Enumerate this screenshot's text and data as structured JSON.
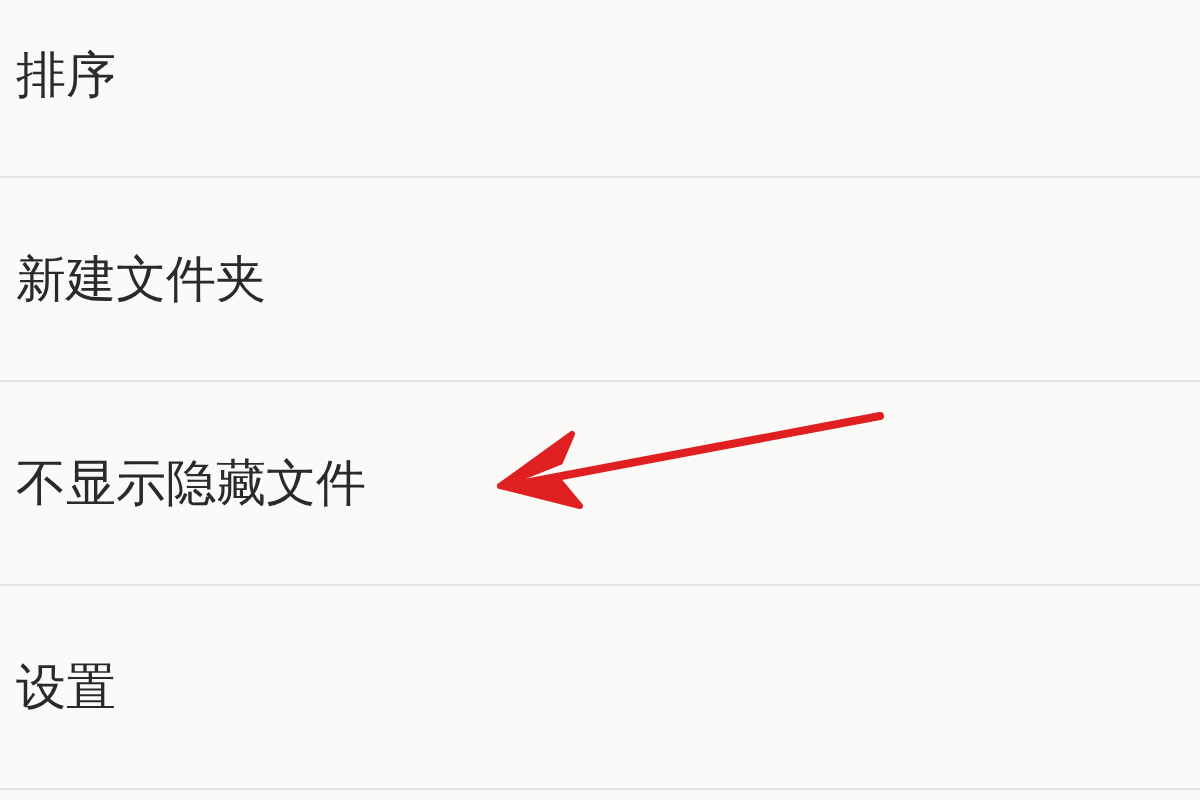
{
  "menu": {
    "items": [
      {
        "label": "排序",
        "pointed_at": false
      },
      {
        "label": "新建文件夹",
        "pointed_at": false
      },
      {
        "label": "不显示隐藏文件",
        "pointed_at": true
      },
      {
        "label": "设置",
        "pointed_at": false
      }
    ]
  }
}
